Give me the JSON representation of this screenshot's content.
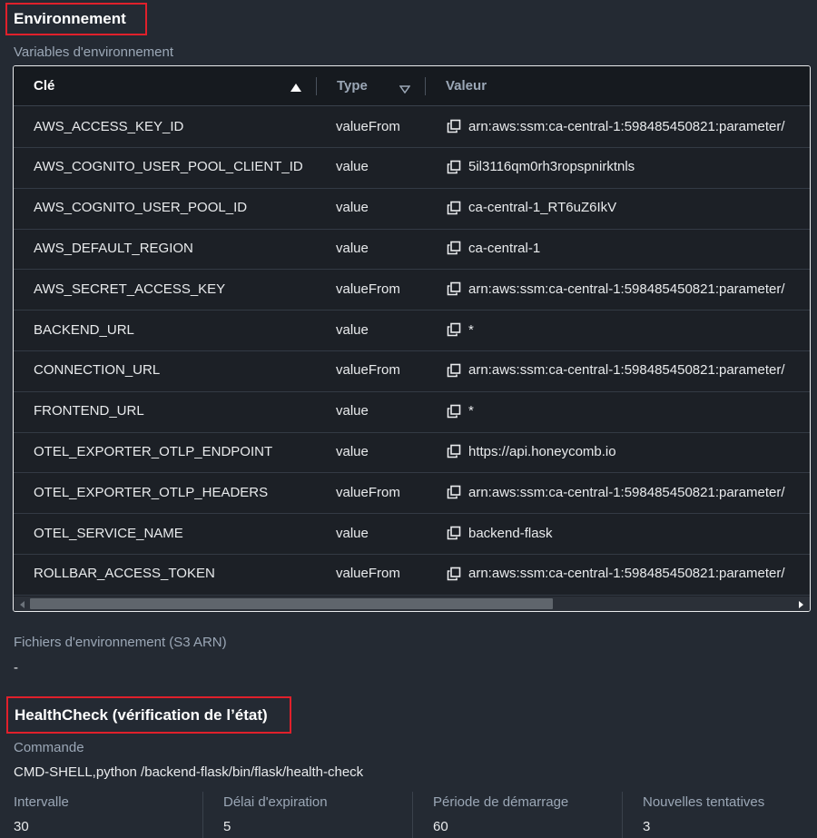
{
  "environment": {
    "title": "Environnement",
    "variables_label": "Variables d'environnement",
    "columns": {
      "key": "Clé",
      "type": "Type",
      "value": "Valeur"
    },
    "rows": [
      {
        "key": "AWS_ACCESS_KEY_ID",
        "type": "valueFrom",
        "value": "arn:aws:ssm:ca-central-1:598485450821:parameter/"
      },
      {
        "key": "AWS_COGNITO_USER_POOL_CLIENT_ID",
        "type": "value",
        "value": "5il3116qm0rh3ropspnirktnls"
      },
      {
        "key": "AWS_COGNITO_USER_POOL_ID",
        "type": "value",
        "value": "ca-central-1_RT6uZ6IkV"
      },
      {
        "key": "AWS_DEFAULT_REGION",
        "type": "value",
        "value": "ca-central-1"
      },
      {
        "key": "AWS_SECRET_ACCESS_KEY",
        "type": "valueFrom",
        "value": "arn:aws:ssm:ca-central-1:598485450821:parameter/"
      },
      {
        "key": "BACKEND_URL",
        "type": "value",
        "value": "*"
      },
      {
        "key": "CONNECTION_URL",
        "type": "valueFrom",
        "value": "arn:aws:ssm:ca-central-1:598485450821:parameter/"
      },
      {
        "key": "FRONTEND_URL",
        "type": "value",
        "value": "*"
      },
      {
        "key": "OTEL_EXPORTER_OTLP_ENDPOINT",
        "type": "value",
        "value": "https://api.honeycomb.io"
      },
      {
        "key": "OTEL_EXPORTER_OTLP_HEADERS",
        "type": "valueFrom",
        "value": "arn:aws:ssm:ca-central-1:598485450821:parameter/"
      },
      {
        "key": "OTEL_SERVICE_NAME",
        "type": "value",
        "value": "backend-flask"
      },
      {
        "key": "ROLLBAR_ACCESS_TOKEN",
        "type": "valueFrom",
        "value": "arn:aws:ssm:ca-central-1:598485450821:parameter/"
      }
    ],
    "files_label": "Fichiers d'environnement (S3 ARN)",
    "files_value": "-"
  },
  "healthcheck": {
    "title": "HealthCheck (vérification de l’état)",
    "command_label": "Commande",
    "command_value": "CMD-SHELL,python /backend-flask/bin/flask/health-check",
    "stats": [
      {
        "label": "Intervalle",
        "value": "30"
      },
      {
        "label": "Délai d'expiration",
        "value": "5"
      },
      {
        "label": "Période de démarrage",
        "value": "60"
      },
      {
        "label": "Nouvelles tentatives",
        "value": "3"
      }
    ]
  },
  "icons": {
    "sort_asc": "caret-up-icon",
    "sort_none": "caret-down-outline-icon",
    "copy": "copy-icon"
  }
}
